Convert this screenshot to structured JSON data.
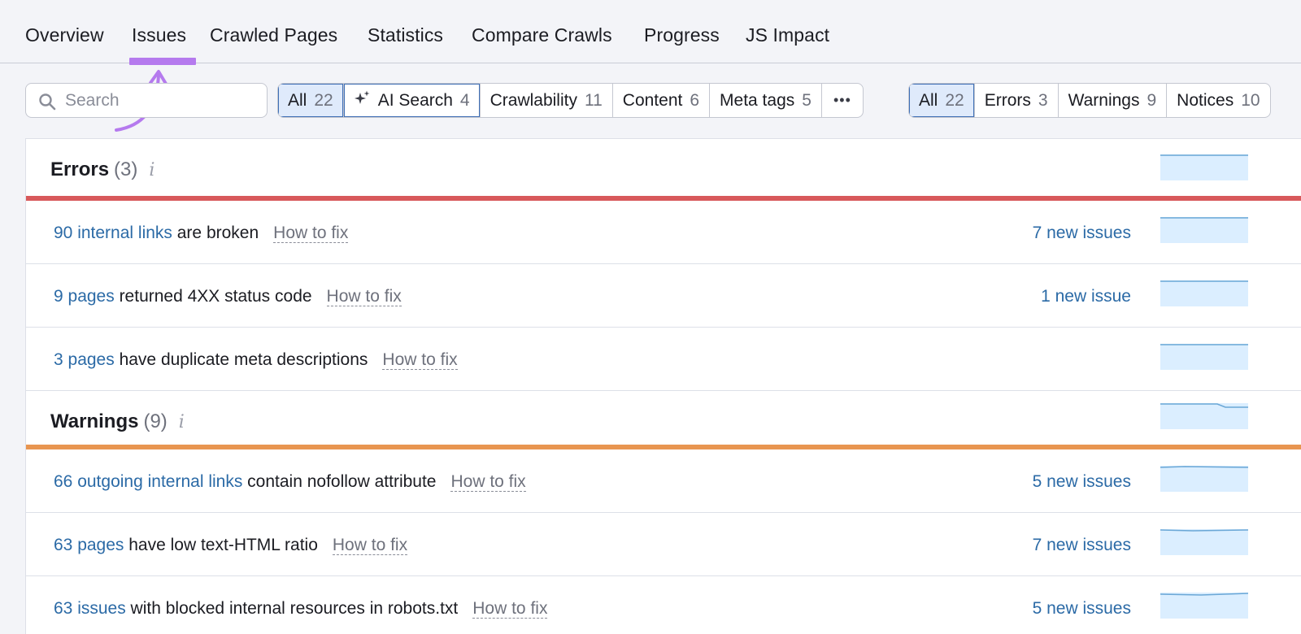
{
  "tabs": [
    {
      "label": "Overview"
    },
    {
      "label": "Issues"
    },
    {
      "label": "Crawled Pages"
    },
    {
      "label": "Statistics"
    },
    {
      "label": "Compare Crawls"
    },
    {
      "label": "Progress"
    },
    {
      "label": "JS Impact"
    }
  ],
  "active_tab": "Issues",
  "search": {
    "placeholder": "Search",
    "value": ""
  },
  "category_filters": [
    {
      "label": "All",
      "count": "22"
    },
    {
      "label": "AI Search",
      "count": "4"
    },
    {
      "label": "Crawlability",
      "count": "11"
    },
    {
      "label": "Content",
      "count": "6"
    },
    {
      "label": "Meta tags",
      "count": "5"
    }
  ],
  "more_label": "•••",
  "severity_filters": [
    {
      "label": "All",
      "count": "22"
    },
    {
      "label": "Errors",
      "count": "3"
    },
    {
      "label": "Warnings",
      "count": "9"
    },
    {
      "label": "Notices",
      "count": "10"
    }
  ],
  "errors": {
    "title": "Errors",
    "count": "(3)",
    "info": "i",
    "color": "#d8595b",
    "rows": [
      {
        "link": "90 internal links",
        "rest": " are broken",
        "howto": "How to fix",
        "new": "7 new issues"
      },
      {
        "link": "9 pages",
        "rest": " returned 4XX status code",
        "howto": "How to fix",
        "new": "1 new issue"
      },
      {
        "link": "3 pages",
        "rest": " have duplicate meta descriptions",
        "howto": "How to fix",
        "new": ""
      }
    ]
  },
  "warnings": {
    "title": "Warnings",
    "count": "(9)",
    "info": "i",
    "color": "#e89550",
    "rows": [
      {
        "link": "66 outgoing internal links",
        "rest": " contain nofollow attribute",
        "howto": "How to fix",
        "new": "5 new issues"
      },
      {
        "link": "63 pages",
        "rest": " have low text-HTML ratio",
        "howto": "How to fix",
        "new": "7 new issues"
      },
      {
        "link": "63 issues",
        "rest": " with blocked internal resources in robots.txt",
        "howto": "How to fix",
        "new": "5 new issues"
      }
    ]
  },
  "colors": {
    "link": "#2b6aa6",
    "accent": "#b57aee",
    "active_filter_bg": "#dfeafb",
    "sparkline_fill": "#dbeeff"
  }
}
